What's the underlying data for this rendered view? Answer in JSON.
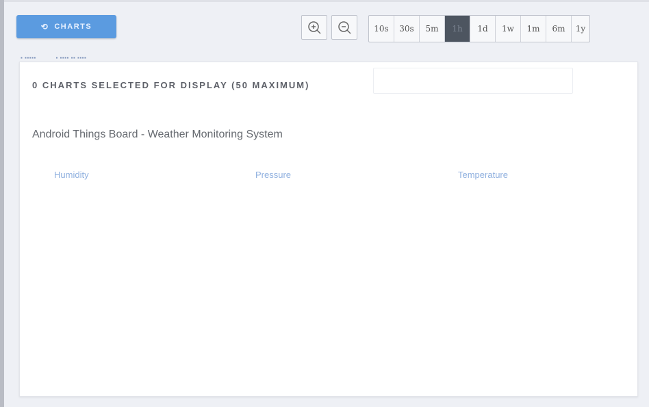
{
  "toolbar": {
    "charts_button_label": "CHARTS",
    "zoom_in_icon": "zoom-in-icon",
    "zoom_out_icon": "zoom-out-icon",
    "time_ranges": [
      "10s",
      "30s",
      "5m",
      "1h",
      "1d",
      "1w",
      "1m",
      "6m",
      "1y"
    ],
    "active_range": "1h"
  },
  "panel": {
    "header": "0 CHARTS SELECTED FOR DISPLAY (50 MAXIMUM)",
    "board_title": "Android Things Board - Weather Monitoring System",
    "charts": [
      "Humidity",
      "Pressure",
      "Temperature"
    ]
  },
  "colors": {
    "accent": "#5b9be0",
    "link": "#8fb0df",
    "active_range_bg": "#4d5560"
  }
}
